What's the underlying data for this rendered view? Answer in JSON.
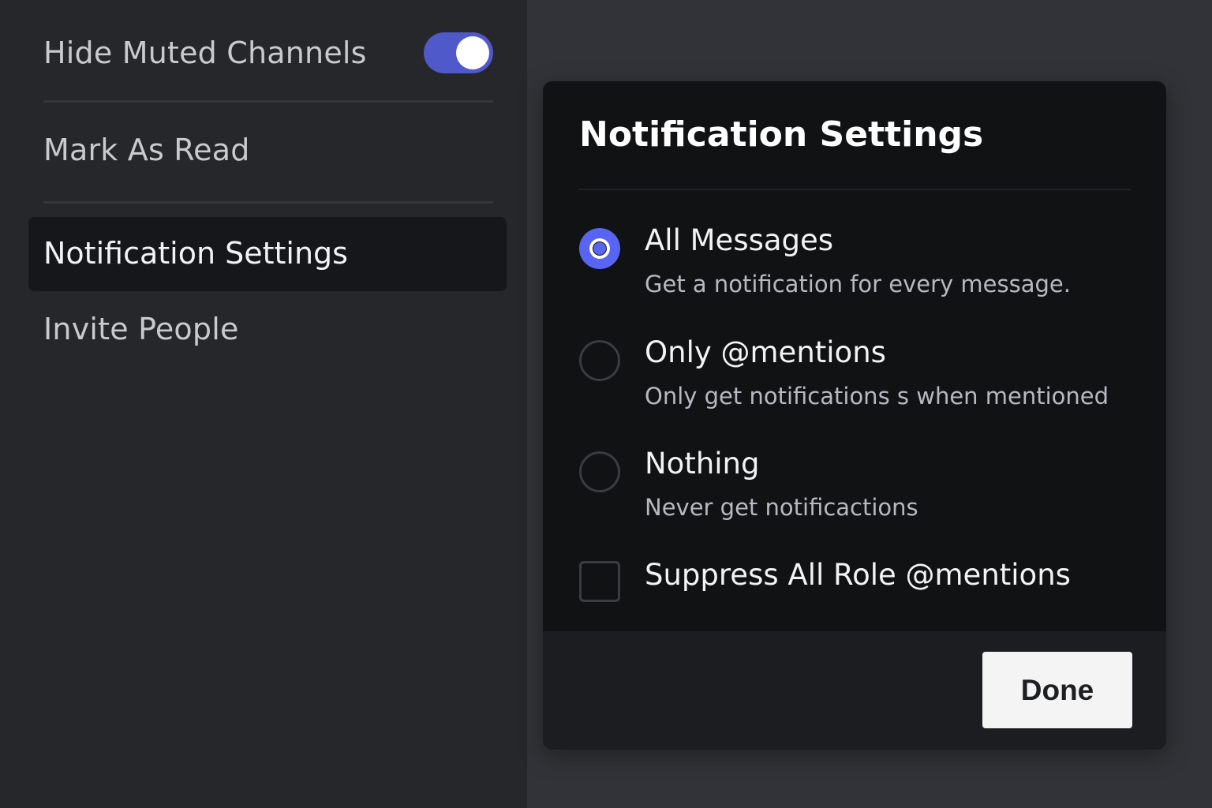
{
  "menu": {
    "hide_muted": "Hide Muted Channels",
    "hide_muted_enabled": true,
    "mark_read": "Mark As Read",
    "notification_settings": "Notification Settings",
    "invite_people": "Invite People"
  },
  "modal": {
    "title": "Notification Settings",
    "options": [
      {
        "label": "All Messages",
        "description": "Get a notification for every message.",
        "selected": true
      },
      {
        "label": "Only @mentions",
        "description": "Only get notifications s when mentioned",
        "selected": false
      },
      {
        "label": "Nothing",
        "description": "Never get notificactions",
        "selected": false
      }
    ],
    "suppress_label": "Suppress All Role @mentions",
    "suppress_checked": false,
    "done_label": "Done"
  },
  "colors": {
    "accent": "#5865f2",
    "panel": "#25272b",
    "modal": "#111214"
  }
}
